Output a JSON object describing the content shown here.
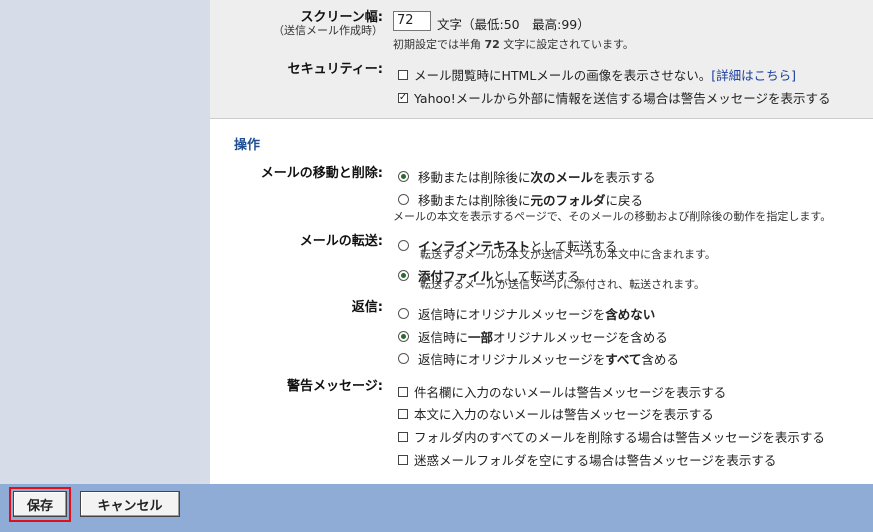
{
  "display": {
    "screen_width_label": "スクリーン幅:",
    "screen_width_sub": "（送信メール作成時）",
    "screen_width_value": "72",
    "screen_width_unit": "文字（最低:50　最高:99）",
    "screen_width_note_pre": "初期設定では半角 ",
    "screen_width_note_bold": "72",
    "screen_width_note_post": " 文字に設定されています。",
    "security_label": "セキュリティー:",
    "security_opt1_pre": "メール閲覧時にHTMLメールの画像を表示させない。",
    "security_opt1_link": "[詳細はこちら]",
    "security_opt2": "Yahoo!メールから外部に情報を送信する場合は警告メッセージを表示する",
    "security_opt1_checked": false,
    "security_opt2_checked": true
  },
  "operations": {
    "section_title": "操作",
    "move_delete_label": "メールの移動と削除:",
    "move_opt1_pre": "移動または削除後に ",
    "move_opt1_bold": "次のメール",
    "move_opt1_post": " を表示する",
    "move_opt2_pre": "移動または削除後に ",
    "move_opt2_bold": "元のフォルダ",
    "move_opt2_post": " に戻る",
    "move_note": "メールの本文を表示するページで、そのメールの移動および削除後の動作を指定します。",
    "forward_label": "メールの転送:",
    "fwd_opt1_bold": "インラインテキスト",
    "fwd_opt1_post": "として転送する",
    "fwd_opt1_note": "転送するメールの本文が送信メールの本文中に含まれます。",
    "fwd_opt2_bold": "添付ファイル",
    "fwd_opt2_post": "として転送する",
    "fwd_opt2_note": "転送するメールが送信メールに添付され、転送されます。",
    "reply_label": "返信:",
    "reply_opt1_pre": "返信時にオリジナルメッセージを",
    "reply_opt1_bold": "含めない",
    "reply_opt2_pre": "返信時に ",
    "reply_opt2_bold": "一部",
    "reply_opt2_post": " オリジナルメッセージを含める",
    "reply_opt3_pre": "返信時にオリジナルメッセージを ",
    "reply_opt3_bold": "すべて",
    "reply_opt3_post": " 含める",
    "warn_label": "警告メッセージ:",
    "warn_opt1": "件名欄に入力のないメールは警告メッセージを表示する",
    "warn_opt2": "本文に入力のないメールは警告メッセージを表示する",
    "warn_opt3": "フォルダ内のすべてのメールを削除する場合は警告メッセージを表示する",
    "warn_opt4": "迷惑メールフォルダを空にする場合は警告メッセージを表示する"
  },
  "selected": {
    "move": "next",
    "forward": "attachment",
    "reply": "partial"
  },
  "footer": {
    "save_label": "保存",
    "cancel_label": "キャンセル"
  },
  "colors": {
    "sidebar": "#d6dde8",
    "footer": "#8eacd6",
    "section_title": "#1f4f92",
    "highlight": "#e0101a"
  }
}
